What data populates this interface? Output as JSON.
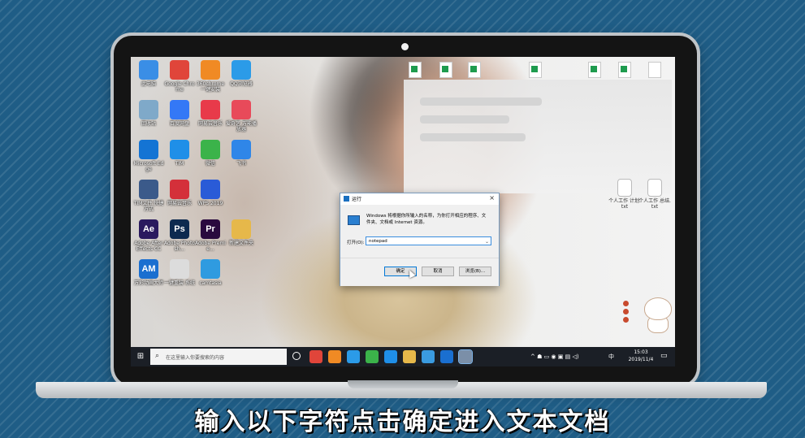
{
  "desktop": {
    "icons": [
      {
        "label": "此电脑",
        "color": "#3a8ee6",
        "icon": "computer-icon"
      },
      {
        "label": "Google Chrome",
        "color": "#e0453a",
        "icon": "chrome-icon"
      },
      {
        "label": "360chrome 一键安装",
        "color": "#f08a24",
        "icon": "browser-icon"
      },
      {
        "label": "QQ浏览器",
        "color": "#2b9be8",
        "icon": "qq-browser-icon"
      },
      {
        "label": "回收站",
        "color": "#7fa9c9",
        "icon": "recycle-bin-icon"
      },
      {
        "label": "百度网盘",
        "color": "#3478f6",
        "icon": "baidu-netdisk-icon"
      },
      {
        "label": "网易云音乐",
        "color": "#e83a4a",
        "icon": "music-icon"
      },
      {
        "label": "爱奇艺 万能播放器",
        "color": "#e84a5a",
        "icon": "player-icon"
      },
      {
        "label": "Microsoft Edge",
        "color": "#1474d4",
        "icon": "edge-icon"
      },
      {
        "label": "TIM",
        "color": "#1f8fe8",
        "icon": "tim-icon"
      },
      {
        "label": "微信",
        "color": "#3bb34a",
        "icon": "wechat-icon"
      },
      {
        "label": "飞书",
        "color": "#2f86e8",
        "icon": "feishu-icon"
      },
      {
        "label": "TIM文件 快捷方式",
        "color": "#3b5a8a",
        "icon": "folder-icon"
      },
      {
        "label": "网易云音乐",
        "color": "#d4303a",
        "icon": "netease-music-icon"
      },
      {
        "label": "WPS 2019",
        "color": "#2a5bd7",
        "icon": "wps-icon"
      },
      {
        "label": "Adobe After Effects CC",
        "glyph": "Ae",
        "color": "#2a1a5e",
        "icon": "after-effects-icon"
      },
      {
        "label": "Adobe Photosh...",
        "glyph": "Ps",
        "color": "#0d2a4f",
        "icon": "photoshop-icon"
      },
      {
        "label": "Adobe Premie...",
        "glyph": "Pr",
        "color": "#2a0a3e",
        "icon": "premiere-icon"
      },
      {
        "label": "新建文件夹",
        "color": "#e6b84a",
        "icon": "folder-icon"
      },
      {
        "label": "万彩动画大师",
        "glyph": "AM",
        "color": "#1a6fd0",
        "icon": "animiz-icon"
      },
      {
        "label": "一键重装 系统",
        "color": "#dcdcdc",
        "icon": "reinstall-icon"
      },
      {
        "label": "camtasia",
        "color": "#2f9be0",
        "icon": "camtasia-icon"
      }
    ],
    "right_docs": [
      "个人工作 计划.txt",
      "个人工作 总结.txt"
    ]
  },
  "run_dialog": {
    "title": "运行",
    "close": "×",
    "description": "Windows 将根据你所输入的名称，为你打开相应的程序、文件夹、文档或 Internet 资源。",
    "open_label": "打开(O):",
    "input_value": "notepad",
    "ok": "确定",
    "cancel": "取消",
    "browse": "浏览(B)..."
  },
  "taskbar": {
    "search_placeholder": "在这里输入你要搜索的内容",
    "tray": "^ ☗ ▭ ◉ ▣ ▤ ◁)",
    "ime": "中",
    "time": "15:03",
    "date": "2019/11/4",
    "apps": [
      "#e0453a",
      "#f08a24",
      "#2b9be8",
      "#3bb34a",
      "#1f8fe8",
      "#e6b84a",
      "#3a9be0",
      "#1a6fd0",
      "#7b8fa8"
    ]
  },
  "subtitle": "输入以下字符点击确定进入文本文档",
  "colors": {
    "background": "#1f5d86",
    "taskbar": "#1b1f26",
    "accent": "#0078d7"
  }
}
